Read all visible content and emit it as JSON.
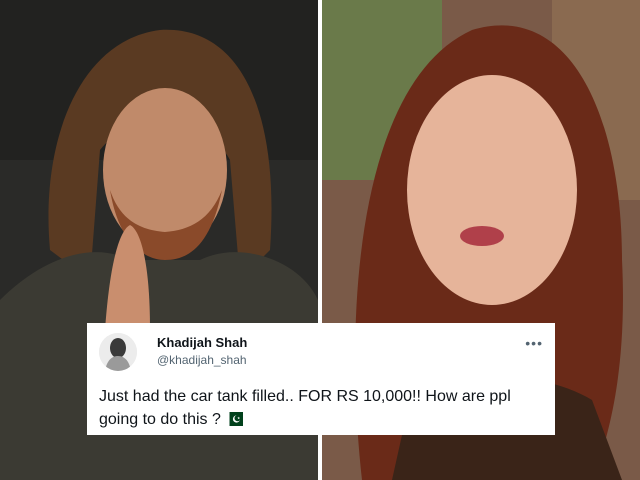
{
  "tweet": {
    "author_name": "Khadijah Shah",
    "author_handle": "@khadijah_shah",
    "more_icon": "more-options-icon",
    "text": "Just had the car tank filled.. FOR RS 10,000!! How are ppl going to do this ?",
    "flag_icon": "pakistan-flag-icon"
  },
  "colors": {
    "card_background": "#ffffff",
    "name_text": "#0f1419",
    "handle_text": "#536471",
    "flag_green": "#01411c"
  }
}
